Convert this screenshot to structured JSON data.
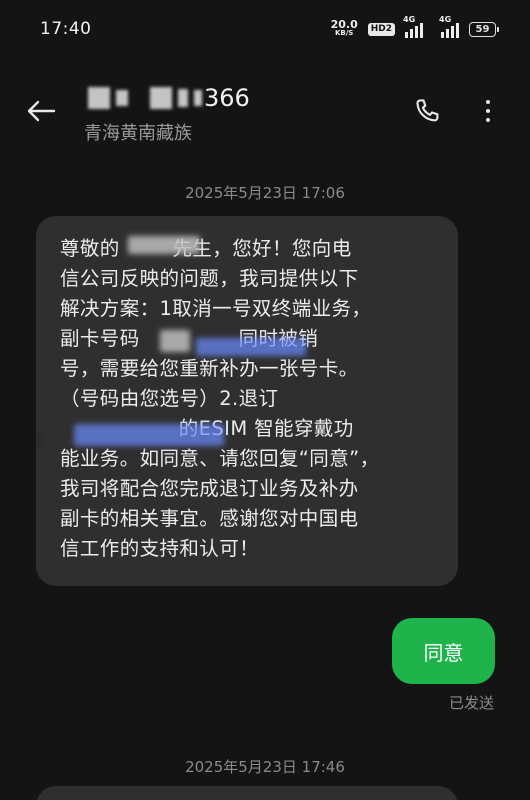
{
  "status_bar": {
    "time": "17:40",
    "net_speed_value": "20.0",
    "net_speed_unit": "KB/S",
    "hd_label": "HD2",
    "sim1_label": "4G",
    "sim2_label": "4G",
    "battery": "59"
  },
  "header": {
    "contact_number_suffix": "366",
    "contact_location": "青海黄南藏族",
    "icons": {
      "back": "back-arrow-icon",
      "call": "phone-icon",
      "more": "more-vertical-icon"
    }
  },
  "messages": [
    {
      "timestamp": "2025年5月23日 17:06",
      "direction": "incoming",
      "text": "尊敬的        先生，您好！您向电\n信公司反映的问题，我司提供以下\n解决方案：1取消一号双终端业务，\n副卡号码               同时被销\n号，需要给您重新补办一张号卡。\n（号码由您选号）2.退订\n                  的ESIM 智能穿戴功\n能业务。如同意、请您回复“同意”，\n我司将配合您完成退订业务及补办\n副卡的相关事宜。感谢您对中国电\n信工作的支持和认可！"
    },
    {
      "direction": "outgoing",
      "text": "同意",
      "status": "已发送"
    },
    {
      "timestamp": "2025年5月23日 17:46",
      "direction": "incoming",
      "text": ""
    }
  ],
  "colors": {
    "background": "#141414",
    "incoming_bubble": "#2f2f2f",
    "outgoing_bubble": "#1fb34b",
    "secondary_text": "#8a8a8a"
  }
}
